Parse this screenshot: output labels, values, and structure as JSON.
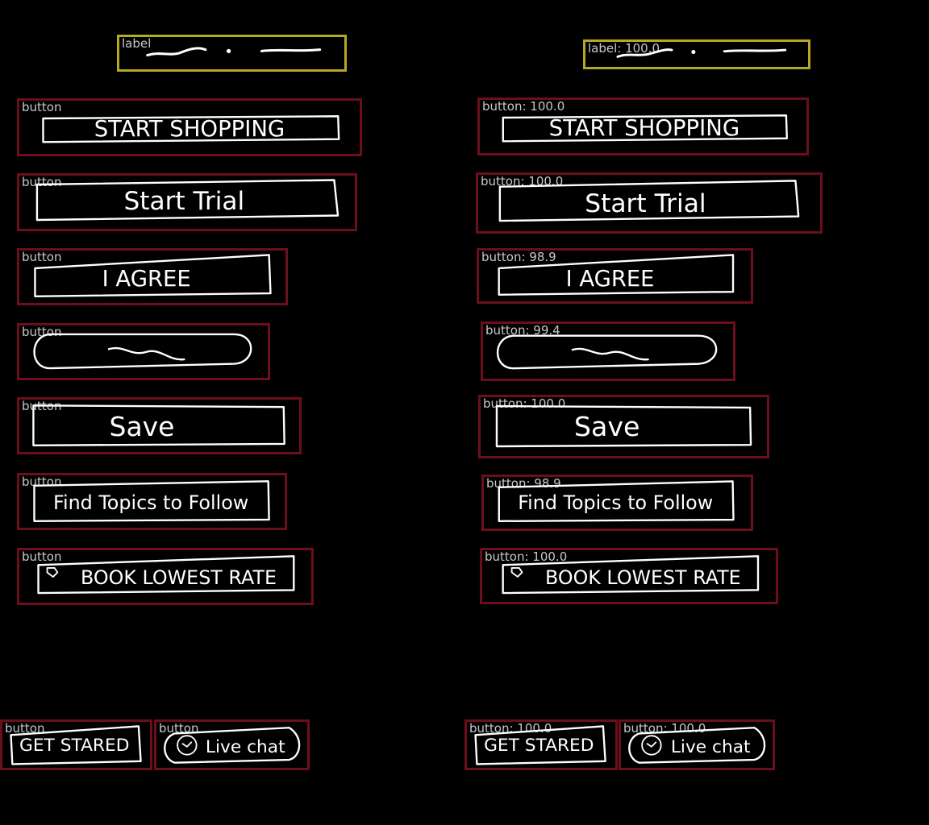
{
  "colors": {
    "background": "#000000",
    "label_box": "#b5a923",
    "button_box": "#6b0f1c",
    "tag_text": "#c8c8c8",
    "sketch_ink": "#ffffff"
  },
  "left_panel": {
    "items": [
      {
        "tag": "label",
        "text": ""
      },
      {
        "tag": "button",
        "text": "START SHOPPING"
      },
      {
        "tag": "button",
        "text": "Start Trial"
      },
      {
        "tag": "button",
        "text": "I AGREE"
      },
      {
        "tag": "button",
        "text": ""
      },
      {
        "tag": "button",
        "text": "Save"
      },
      {
        "tag": "button",
        "text": "Find Topics to Follow"
      },
      {
        "tag": "button",
        "text": "BOOK LOWEST RATE",
        "icon": "tag-icon"
      },
      {
        "tag": "button",
        "text": "GET STARED"
      },
      {
        "tag": "button",
        "text": "Live chat",
        "icon": "chat-icon"
      }
    ]
  },
  "right_panel": {
    "items": [
      {
        "tag": "label: 100.0",
        "text": ""
      },
      {
        "tag": "button: 100.0",
        "text": "START SHOPPING"
      },
      {
        "tag": "button: 100.0",
        "text": "Start Trial"
      },
      {
        "tag": "button: 98.9",
        "text": "I AGREE"
      },
      {
        "tag": "button: 99.4",
        "text": ""
      },
      {
        "tag": "button: 100.0",
        "text": "Save"
      },
      {
        "tag": "button: 98.9",
        "text": "Find Topics to Follow"
      },
      {
        "tag": "button: 100.0",
        "text": "BOOK LOWEST RATE",
        "icon": "tag-icon"
      },
      {
        "tag": "button: 100.0",
        "text": "GET STARED"
      },
      {
        "tag": "button: 100.0",
        "text": "Live chat",
        "icon": "chat-icon"
      }
    ]
  }
}
